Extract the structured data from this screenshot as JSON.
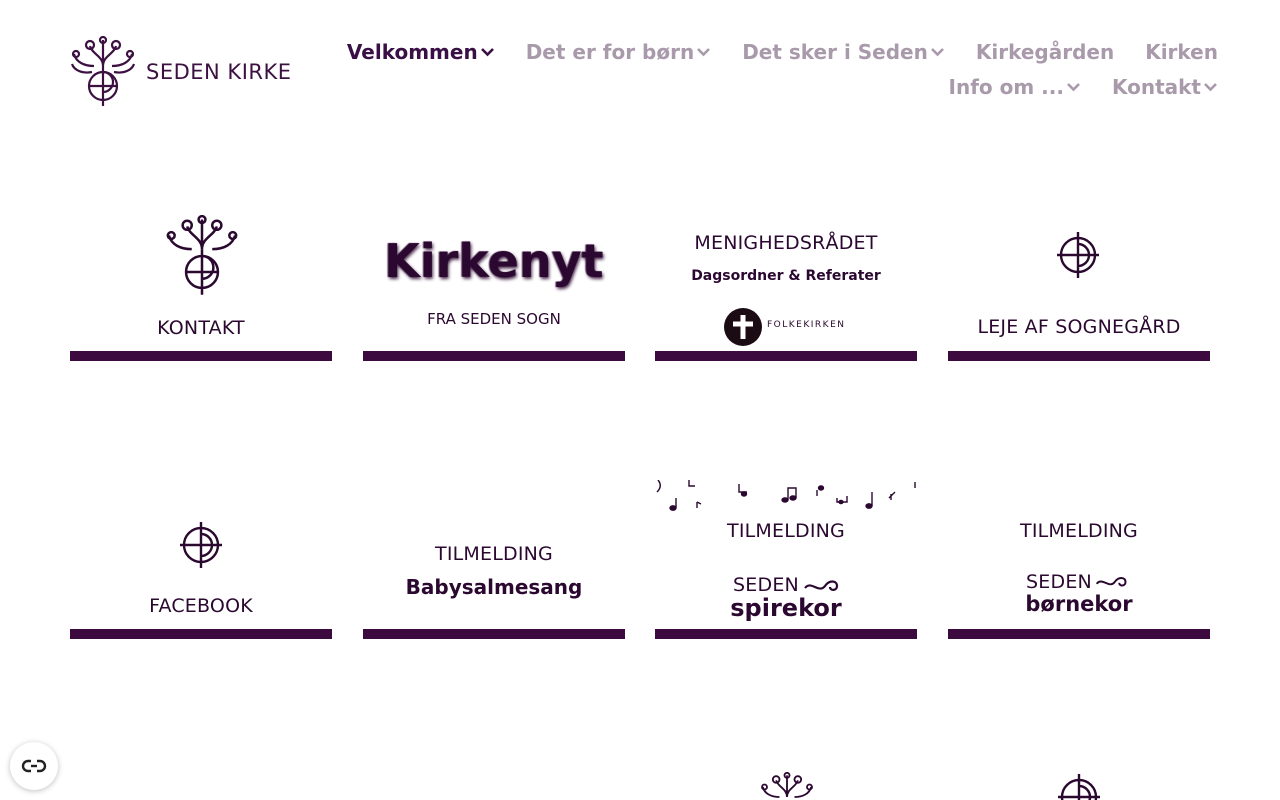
{
  "site": {
    "logo_text": "SEDEN KIRKE"
  },
  "nav": {
    "row1": [
      {
        "label": "Velkommen",
        "active": true,
        "dropdown": true
      },
      {
        "label": "Det er for børn",
        "dropdown": true
      },
      {
        "label": "Det sker i Seden",
        "dropdown": true
      },
      {
        "label": "Kirkegården",
        "dropdown": false
      },
      {
        "label": "Kirken",
        "dropdown": false
      }
    ],
    "row2": [
      {
        "label": "Info om ...",
        "dropdown": true
      },
      {
        "label": "Kontakt",
        "dropdown": true
      }
    ]
  },
  "tiles": {
    "kontakt": {
      "label": "KONTAKT"
    },
    "kirkenyt": {
      "title": "Kirkenyt",
      "subtitle": "FRA SEDEN SOGN"
    },
    "menighedsraadet": {
      "title": "MENIGHEDSRÅDET",
      "subtitle": "Dagsordner & Referater",
      "badge": "FOLKEKIRKEN"
    },
    "leje": {
      "label": "LEJE AF SOGNEGÅRD"
    },
    "facebook": {
      "label": "FACEBOOK"
    },
    "babysalmesang": {
      "title": "TILMELDING",
      "subtitle": "Babysalmesang"
    },
    "spirekor": {
      "title": "TILMELDING",
      "line1": "SEDEN",
      "line2": "spirekor"
    },
    "bornekor": {
      "title": "TILMELDING",
      "line1": "SEDEN",
      "line2": "børnekor"
    }
  },
  "colors": {
    "brand": "#3c0a3f",
    "nav_inactive": "#a99aab",
    "nav_active": "#3a0f45"
  },
  "icons": {
    "cookie": "cookie-settings-icon",
    "chevron": "chevron-down-icon",
    "logo": "church-emblem-icon"
  }
}
